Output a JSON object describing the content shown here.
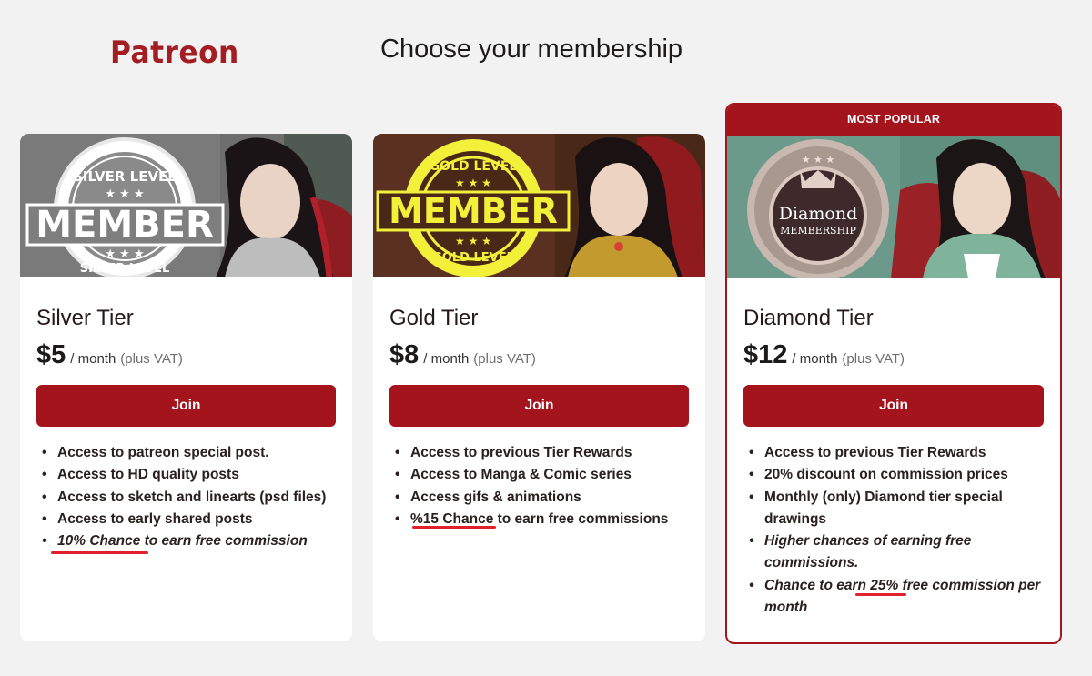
{
  "header": {
    "logo_text": "Patreon",
    "title": "Choose your membership"
  },
  "colors": {
    "accent": "#a4141c",
    "page_background": "#f2f2f2",
    "underline": "#e0202a"
  },
  "tiers": [
    {
      "name": "Silver Tier",
      "price": "$5",
      "period": "/ month",
      "vat_note": "(plus VAT)",
      "join_label": "Join",
      "banner": {
        "badge_top": "SILVER LEVEL",
        "badge_main": "MEMBER",
        "badge_bottom": "SILVER LEVEL",
        "stars": "★ ★ ★"
      },
      "benefits": [
        " Access to patreon special post.",
        "Access to HD quality posts",
        "Access to sketch and linearts (psd files)",
        "Access to early shared posts",
        "10% Chance to earn free commission"
      ]
    },
    {
      "name": "Gold Tier",
      "price": "$8",
      "period": "/ month",
      "vat_note": "(plus VAT)",
      "join_label": "Join",
      "banner": {
        "badge_top": "GOLD LEVEL",
        "badge_main": "MEMBER",
        "badge_bottom": "GOLD LEVEL",
        "stars": "★ ★ ★"
      },
      "benefits": [
        "Access to previous Tier Rewards",
        "Access to Manga & Comic series",
        "Access gifs & animations",
        "%15 Chance to earn free commissions"
      ]
    },
    {
      "badge": "MOST POPULAR",
      "name": "Diamond Tier",
      "price": "$12",
      "period": "/ month",
      "vat_note": "(plus VAT)",
      "join_label": "Join",
      "banner": {
        "seal_main": "Diamond",
        "seal_sub": "MEMBERSHIP",
        "stars": "★ ★ ★"
      },
      "benefits": [
        "Access to previous Tier Rewards",
        "20% discount on commission prices",
        "Monthly (only) Diamond tier special drawings",
        "Higher chances of earning free commissions.",
        "Chance to earn 25% free commission per month"
      ]
    }
  ]
}
